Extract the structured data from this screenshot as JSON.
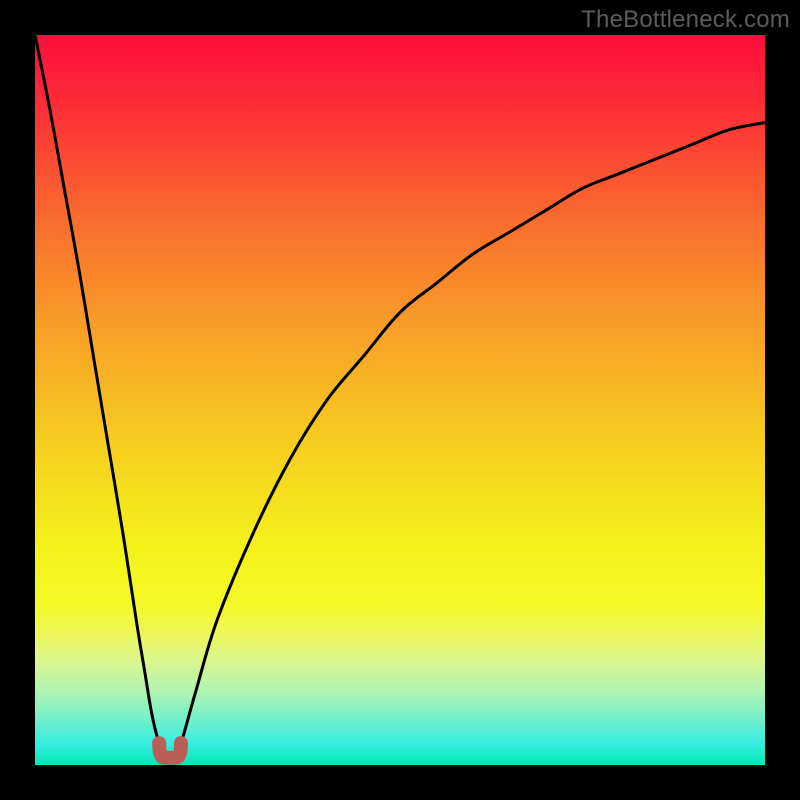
{
  "watermark": {
    "text": "TheBottleneck.com"
  },
  "chart_data": {
    "type": "line",
    "title": "",
    "xlabel": "",
    "ylabel": "",
    "xlim": [
      0,
      100
    ],
    "ylim": [
      0,
      100
    ],
    "grid": false,
    "legend": false,
    "notes": "Bottleneck V-curve over red→green vertical gradient. Minimum (~0%) near x≈18. Left branch rises steeply to ~100% at x=0; right branch rises with decreasing slope to ~88% at x=100.",
    "series": [
      {
        "name": "left-branch",
        "x": [
          0,
          2,
          4,
          6,
          8,
          10,
          12,
          14,
          15,
          16,
          17
        ],
        "values": [
          100,
          90,
          79,
          68,
          56,
          44,
          32,
          19,
          13,
          7,
          3
        ]
      },
      {
        "name": "trough",
        "x": [
          17,
          18,
          19,
          20
        ],
        "values": [
          3,
          1,
          1,
          3
        ]
      },
      {
        "name": "right-branch",
        "x": [
          20,
          22,
          25,
          30,
          35,
          40,
          45,
          50,
          55,
          60,
          65,
          70,
          75,
          80,
          85,
          90,
          95,
          100
        ],
        "values": [
          3,
          10,
          20,
          32,
          42,
          50,
          56,
          62,
          66,
          70,
          73,
          76,
          79,
          81,
          83,
          85,
          87,
          88
        ]
      }
    ],
    "background_gradient_stops": [
      {
        "pct": 0,
        "color": "#fe0e3a"
      },
      {
        "pct": 10,
        "color": "#fd2e36"
      },
      {
        "pct": 25,
        "color": "#fa6b2e"
      },
      {
        "pct": 40,
        "color": "#f89e27"
      },
      {
        "pct": 55,
        "color": "#f6cb20"
      },
      {
        "pct": 70,
        "color": "#f4f11a"
      },
      {
        "pct": 78,
        "color": "#f4f927"
      },
      {
        "pct": 82,
        "color": "#eef75a"
      },
      {
        "pct": 86,
        "color": "#d8f691"
      },
      {
        "pct": 90,
        "color": "#aef3b2"
      },
      {
        "pct": 94,
        "color": "#6fefce"
      },
      {
        "pct": 97,
        "color": "#37eddf"
      },
      {
        "pct": 100,
        "color": "#03e9b6"
      }
    ],
    "trough_marker": {
      "x_start": 17.0,
      "x_end": 20.0,
      "color": "#bb5e57"
    }
  }
}
